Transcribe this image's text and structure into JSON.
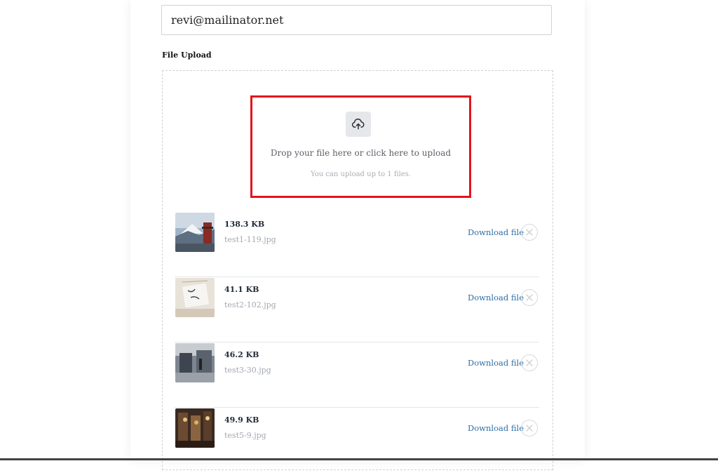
{
  "form": {
    "email_value": "revi@mailinator.net",
    "file_upload_label": "File Upload"
  },
  "dropzone": {
    "prompt": "Drop your file here or click here to upload",
    "limit_text": "You can upload up to 1 files.",
    "icon": "cloud-upload-icon"
  },
  "files": [
    {
      "size": "138.3 KB",
      "name": "test1-119.jpg",
      "download_label": "Download file"
    },
    {
      "size": "41.1 KB",
      "name": "test2-102.jpg",
      "download_label": "Download file"
    },
    {
      "size": "46.2 KB",
      "name": "test3-30.jpg",
      "download_label": "Download file"
    },
    {
      "size": "49.9 KB",
      "name": "test5-9.jpg",
      "download_label": "Download file"
    }
  ],
  "colors": {
    "highlight": "#e3141c",
    "link": "#2f6fa8"
  }
}
